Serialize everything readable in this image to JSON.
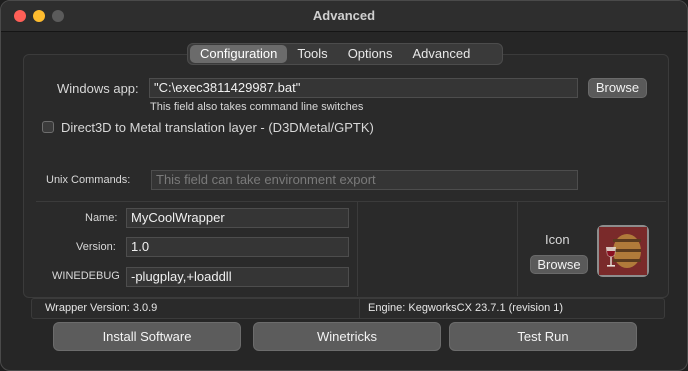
{
  "window": {
    "title": "Advanced"
  },
  "tabs": [
    "Configuration",
    "Tools",
    "Options",
    "Advanced"
  ],
  "active_tab": "Configuration",
  "config": {
    "windows_app_label": "Windows app:",
    "windows_app_value": "\"C:\\exec3811429987.bat\"",
    "browse_label": "Browse",
    "windows_app_hint": "This field also takes command line switches",
    "d3d_label": "Direct3D to Metal translation layer - (D3DMetal/GPTK)",
    "d3d_checked": false,
    "unix_label": "Unix Commands:",
    "unix_placeholder": "This field can take environment export"
  },
  "wrapper": {
    "name_label": "Name:",
    "name_value": "MyCoolWrapper",
    "version_label": "Version:",
    "version_value": "1.0",
    "winedebug_label": "WINEDEBUG",
    "winedebug_value": "-plugplay,+loaddll",
    "icon_label": "Icon",
    "icon_browse_label": "Browse",
    "icon_name": "wine-barrel-icon"
  },
  "status": {
    "wrapper_version": "Wrapper Version:   3.0.9",
    "engine": "Engine: KegworksCX 23.7.1 (revision 1)"
  },
  "buttons": {
    "install": "Install Software",
    "winetricks": "Winetricks",
    "test_run": "Test Run"
  }
}
